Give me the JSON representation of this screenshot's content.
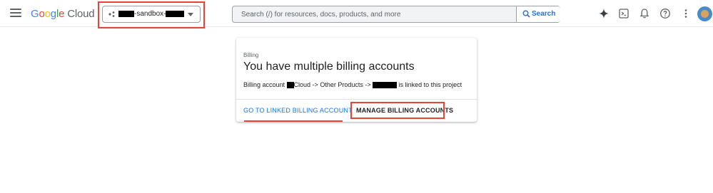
{
  "header": {
    "brand_google_letters": [
      "G",
      "o",
      "o",
      "g",
      "l",
      "e"
    ],
    "brand_product": "Cloud",
    "project": {
      "prefix": "-sandbox-"
    },
    "search": {
      "placeholder": "Search (/) for resources, docs, products, and more",
      "button_label": "Search"
    },
    "icons": [
      "menu-icon",
      "gemini-sparkle-icon",
      "cloud-shell-icon",
      "notifications-icon",
      "help-icon",
      "more-vert-icon",
      "avatar"
    ]
  },
  "card": {
    "eyebrow": "Billing",
    "title": "You have multiple billing accounts",
    "desc_part1": "Billing account ",
    "desc_part2": "Cloud -> Other Products -> ",
    "desc_part3": " is linked to this project",
    "link_button": "GO TO LINKED BILLING ACCOUNT",
    "manage_button": "MANAGE BILLING ACCOUNTS"
  },
  "colors": {
    "accent": "#1a73e8",
    "highlight": "#ea4335"
  }
}
